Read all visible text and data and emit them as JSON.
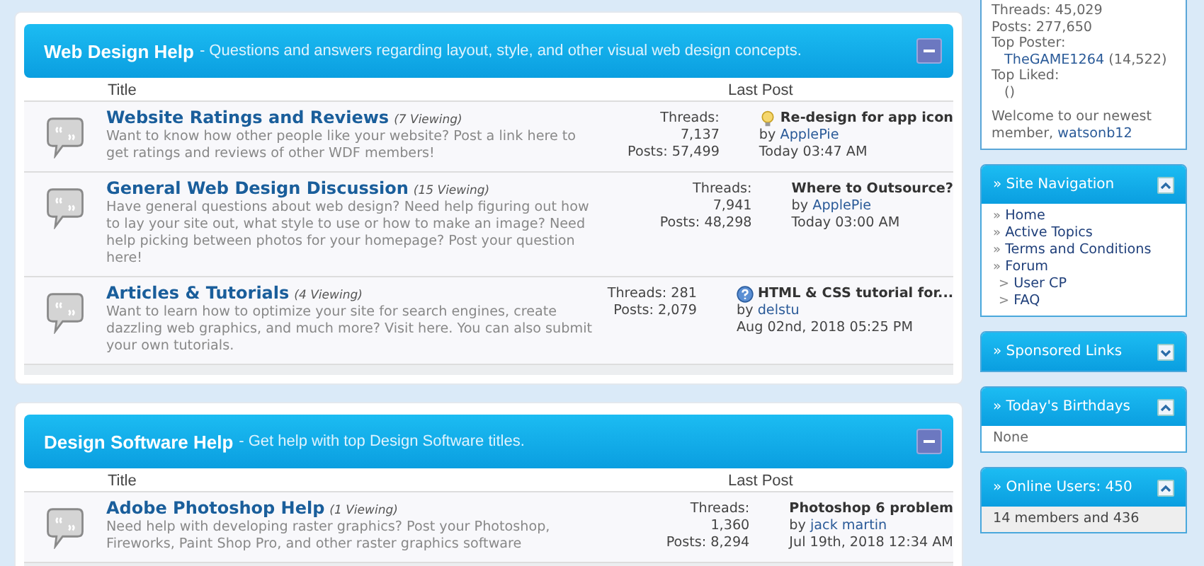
{
  "sections": [
    {
      "title": "Web Design Help",
      "description": "- Questions and answers regarding layout, style, and other visual web design concepts.",
      "expanded": true,
      "columns": [
        "Title",
        "Last Post"
      ],
      "forums": [
        {
          "name": "Website Ratings and Reviews",
          "viewing": "(7 Viewing)",
          "description": "Want to know how other people like your website? Post a link here to get ratings and reviews of other WDF members!",
          "threads_label": "Threads:",
          "threads": "7,137",
          "posts": "Posts: 57,499",
          "stats_inline": false,
          "kind": "lightbulb",
          "last_title": "Re-design for app icon",
          "by": "by",
          "last_user": "ApplePie",
          "last_time": "Today 03:47 AM"
        },
        {
          "name": "General Web Design Discussion",
          "viewing": "(15 Viewing)",
          "description": "Have general questions about web design? Need help figuring out how to lay your site out, what style to use or how to make an image? Need help picking between photos for your homepage? Post your question here!",
          "threads_label": "Threads:",
          "threads": "7,941",
          "posts": "Posts: 48,298",
          "stats_inline": false,
          "kind": "plain",
          "last_title": "Where to Outsource?",
          "by": "by",
          "last_user": "ApplePie",
          "last_time": "Today 03:00 AM"
        },
        {
          "name": "Articles & Tutorials",
          "viewing": "(4 Viewing)",
          "description": "Want to learn how to optimize your site for search engines, create dazzling web graphics, and much more? Visit here. You can also submit your own tutorials.",
          "threads_label": "Threads:",
          "threads": "281",
          "posts": "Posts: 2,079",
          "stats_inline": true,
          "kind": "question",
          "last_title": "HTML & CSS tutorial for...",
          "by": "by",
          "last_user": "delstu",
          "last_time": "Aug 02nd, 2018 05:25 PM"
        }
      ]
    },
    {
      "title": "Design Software Help",
      "description": "- Get help with top Design Software titles.",
      "expanded": true,
      "columns": [
        "Title",
        "Last Post"
      ],
      "forums": [
        {
          "name": "Adobe Photoshop Help",
          "viewing": "(1 Viewing)",
          "description": "Need help with developing raster graphics? Post your Photoshop, Fireworks, Paint Shop Pro, and other raster graphics software",
          "threads_label": "Threads:",
          "threads": "1,360",
          "posts": "Posts: 8,294",
          "stats_inline": false,
          "kind": "plain",
          "last_title": "Photoshop 6 problem",
          "by": "by",
          "last_user": "jack martin",
          "last_time": "Jul 19th, 2018 12:34 AM"
        }
      ]
    }
  ],
  "stats": {
    "threads": "Threads: 45,029",
    "posts": "Posts: 277,650",
    "top_poster_label": "Top Poster:",
    "top_poster": "TheGAME1264",
    "top_poster_count": "(14,522)",
    "top_liked_label": "Top Liked:",
    "top_liked": "()",
    "welcome": "Welcome to our newest member,",
    "newest_member": "watsonb12"
  },
  "sidebar": [
    {
      "kind": "nav",
      "title": "» Site Navigation",
      "expanded": true,
      "items": [
        {
          "bullet": "»",
          "label": "Home"
        },
        {
          "bullet": "»",
          "label": "Active Topics"
        },
        {
          "bullet": "»",
          "label": "Terms and Conditions"
        },
        {
          "bullet": "»",
          "label": "Forum",
          "children": [
            {
              "bullet": ">",
              "label": "User CP"
            },
            {
              "bullet": ">",
              "label": "FAQ"
            }
          ]
        }
      ]
    },
    {
      "title": "» Sponsored Links",
      "expanded": false
    },
    {
      "kind": "text",
      "title": "» Today's Birthdays",
      "expanded": true,
      "text": "None"
    },
    {
      "kind": "text",
      "title": "» Online Users: 450",
      "expanded": true,
      "text": "14 members and 436"
    }
  ]
}
